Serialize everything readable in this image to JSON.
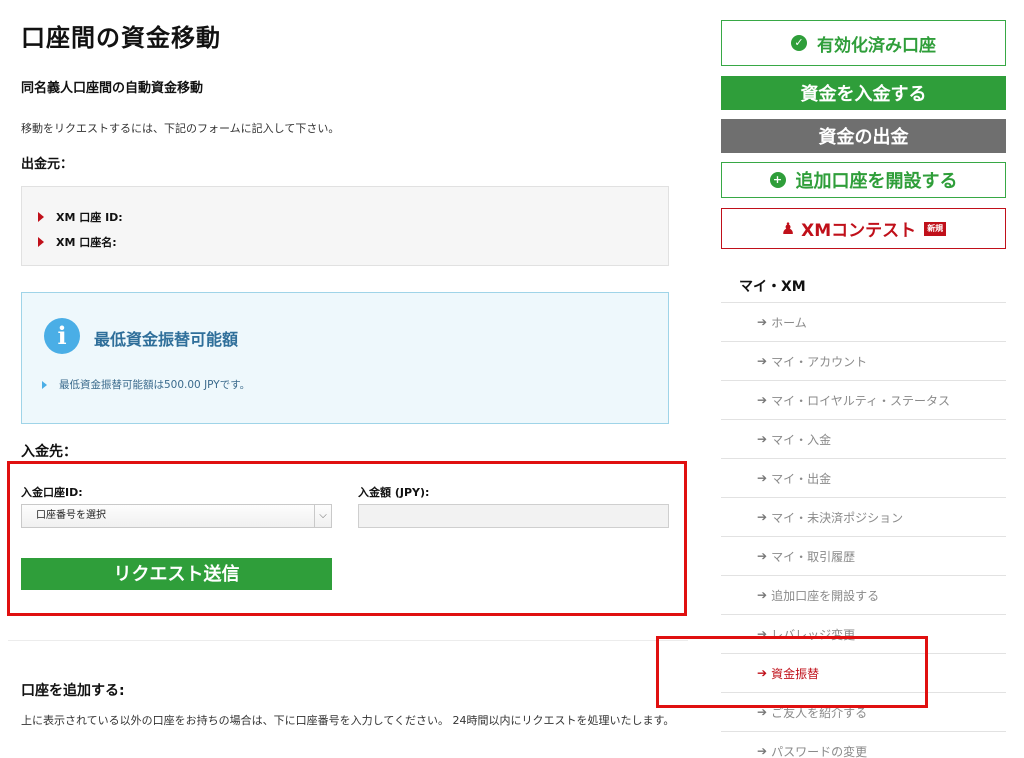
{
  "page": {
    "title": "口座間の資金移動",
    "subtitle": "同名義人口座間の自動資金移動",
    "intro": "移動をリクエストするには、下記のフォームに記入して下さい。"
  },
  "from": {
    "label": "出金元：",
    "account_id_label": "XM 口座 ID:",
    "account_name_label": "XM 口座名:"
  },
  "info": {
    "icon": "info-icon",
    "title": "最低資金振替可能額",
    "text": "最低資金振替可能額は500.00 JPYです。"
  },
  "to": {
    "label": "入金先：",
    "account_id_label": "入金口座ID:",
    "account_select_value": "口座番号を選択",
    "amount_label": "入金額 (JPY):",
    "amount_value": "",
    "submit_label": "リクエスト送信"
  },
  "add_account": {
    "title": "口座を追加する:",
    "text": "上に表示されている以外の口座をお持ちの場合は、下に口座番号を入力してください。 24時間以内にリクエストを処理いたします。"
  },
  "sidebar": {
    "verified_label": "有効化済み口座",
    "deposit_label": "資金を入金する",
    "withdraw_label": "資金の出金",
    "add_account_label": "追加口座を開設する",
    "contest_label": "XMコンテスト",
    "contest_badge": "新規",
    "section_title": "マイ・XM",
    "nav": [
      {
        "label": "ホーム"
      },
      {
        "label": "マイ・アカウント"
      },
      {
        "label": "マイ・ロイヤルティ・ステータス"
      },
      {
        "label": "マイ・入金"
      },
      {
        "label": "マイ・出金"
      },
      {
        "label": "マイ・未決済ポジション"
      },
      {
        "label": "マイ・取引履歴"
      },
      {
        "label": "追加口座を開設する"
      },
      {
        "label": "レバレッジ変更"
      },
      {
        "label": "資金振替"
      },
      {
        "label": "ご友人を紹介する"
      },
      {
        "label": "パスワードの変更"
      }
    ]
  },
  "colors": {
    "green": "#2f9e3a",
    "gray": "#6f6f6f",
    "red": "#c0101a",
    "highlight_frame": "#e01010",
    "info_blue": "#4aaee6"
  }
}
